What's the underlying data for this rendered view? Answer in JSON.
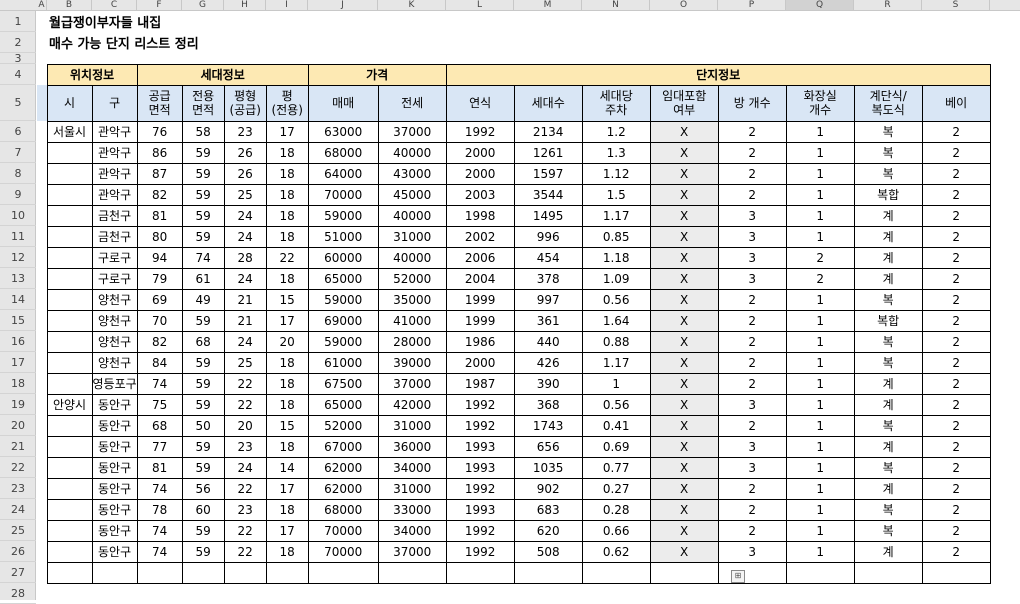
{
  "columns": [
    "A",
    "B",
    "C",
    "F",
    "G",
    "H",
    "I",
    "J",
    "K",
    "L",
    "M",
    "N",
    "O",
    "P",
    "Q",
    "R",
    "S"
  ],
  "row_numbers": [
    1,
    2,
    3,
    4,
    5,
    6,
    7,
    8,
    9,
    10,
    11,
    12,
    13,
    14,
    15,
    16,
    17,
    18,
    19,
    20,
    21,
    22,
    23,
    24,
    25,
    26,
    27,
    28
  ],
  "title1": "월급쟁이부자들 내집",
  "title2": "매수 가능 단지 리스트 정리",
  "groups": {
    "location": "위치정보",
    "household": "세대정보",
    "price": "가격",
    "complex": "단지정보"
  },
  "headers": [
    "시",
    "구",
    "공급\n면적",
    "전용\n면적",
    "평형\n(공급)",
    "평\n(전용)",
    "매매",
    "전세",
    "연식",
    "세대수",
    "세대당\n주차",
    "임대포함\n여부",
    "방 개수",
    "화장실\n개수",
    "계단식/\n복도식",
    "베이"
  ],
  "rows": [
    [
      "서울시",
      "관악구",
      "76",
      "58",
      "23",
      "17",
      "63000",
      "37000",
      "1992",
      "2134",
      "1.2",
      "X",
      "2",
      "1",
      "복",
      "2"
    ],
    [
      "",
      "관악구",
      "86",
      "59",
      "26",
      "18",
      "68000",
      "40000",
      "2000",
      "1261",
      "1.3",
      "X",
      "2",
      "1",
      "복",
      "2"
    ],
    [
      "",
      "관악구",
      "87",
      "59",
      "26",
      "18",
      "64000",
      "43000",
      "2000",
      "1597",
      "1.12",
      "X",
      "2",
      "1",
      "복",
      "2"
    ],
    [
      "",
      "관악구",
      "82",
      "59",
      "25",
      "18",
      "70000",
      "45000",
      "2003",
      "3544",
      "1.5",
      "X",
      "2",
      "1",
      "복합",
      "2"
    ],
    [
      "",
      "금천구",
      "81",
      "59",
      "24",
      "18",
      "59000",
      "40000",
      "1998",
      "1495",
      "1.17",
      "X",
      "3",
      "1",
      "계",
      "2"
    ],
    [
      "",
      "금천구",
      "80",
      "59",
      "24",
      "18",
      "51000",
      "31000",
      "2002",
      "996",
      "0.85",
      "X",
      "3",
      "1",
      "계",
      "2"
    ],
    [
      "",
      "구로구",
      "94",
      "74",
      "28",
      "22",
      "60000",
      "40000",
      "2006",
      "454",
      "1.18",
      "X",
      "3",
      "2",
      "계",
      "2"
    ],
    [
      "",
      "구로구",
      "79",
      "61",
      "24",
      "18",
      "65000",
      "52000",
      "2004",
      "378",
      "1.09",
      "X",
      "3",
      "2",
      "계",
      "2"
    ],
    [
      "",
      "양천구",
      "69",
      "49",
      "21",
      "15",
      "59000",
      "35000",
      "1999",
      "997",
      "0.56",
      "X",
      "2",
      "1",
      "복",
      "2"
    ],
    [
      "",
      "양천구",
      "70",
      "59",
      "21",
      "17",
      "69000",
      "41000",
      "1999",
      "361",
      "1.64",
      "X",
      "2",
      "1",
      "복합",
      "2"
    ],
    [
      "",
      "양천구",
      "82",
      "68",
      "24",
      "20",
      "59000",
      "28000",
      "1986",
      "440",
      "0.88",
      "X",
      "2",
      "1",
      "복",
      "2"
    ],
    [
      "",
      "양천구",
      "84",
      "59",
      "25",
      "18",
      "61000",
      "39000",
      "2000",
      "426",
      "1.17",
      "X",
      "2",
      "1",
      "복",
      "2"
    ],
    [
      "",
      "영등포구",
      "74",
      "59",
      "22",
      "18",
      "67500",
      "37000",
      "1987",
      "390",
      "1",
      "X",
      "2",
      "1",
      "계",
      "2"
    ],
    [
      "안양시",
      "동안구",
      "75",
      "59",
      "22",
      "18",
      "65000",
      "42000",
      "1992",
      "368",
      "0.56",
      "X",
      "3",
      "1",
      "계",
      "2"
    ],
    [
      "",
      "동안구",
      "68",
      "50",
      "20",
      "15",
      "52000",
      "31000",
      "1992",
      "1743",
      "0.41",
      "X",
      "2",
      "1",
      "복",
      "2"
    ],
    [
      "",
      "동안구",
      "77",
      "59",
      "23",
      "18",
      "67000",
      "36000",
      "1993",
      "656",
      "0.69",
      "X",
      "3",
      "1",
      "계",
      "2"
    ],
    [
      "",
      "동안구",
      "81",
      "59",
      "24",
      "14",
      "62000",
      "34000",
      "1993",
      "1035",
      "0.77",
      "X",
      "3",
      "1",
      "복",
      "2"
    ],
    [
      "",
      "동안구",
      "74",
      "56",
      "22",
      "17",
      "62000",
      "31000",
      "1992",
      "902",
      "0.27",
      "X",
      "2",
      "1",
      "계",
      "2"
    ],
    [
      "",
      "동안구",
      "78",
      "60",
      "23",
      "18",
      "68000",
      "33000",
      "1993",
      "683",
      "0.28",
      "X",
      "2",
      "1",
      "복",
      "2"
    ],
    [
      "",
      "동안구",
      "74",
      "59",
      "22",
      "17",
      "70000",
      "34000",
      "1992",
      "620",
      "0.66",
      "X",
      "2",
      "1",
      "복",
      "2"
    ],
    [
      "",
      "동안구",
      "74",
      "59",
      "22",
      "18",
      "70000",
      "37000",
      "1992",
      "508",
      "0.62",
      "X",
      "3",
      "1",
      "계",
      "2"
    ]
  ]
}
